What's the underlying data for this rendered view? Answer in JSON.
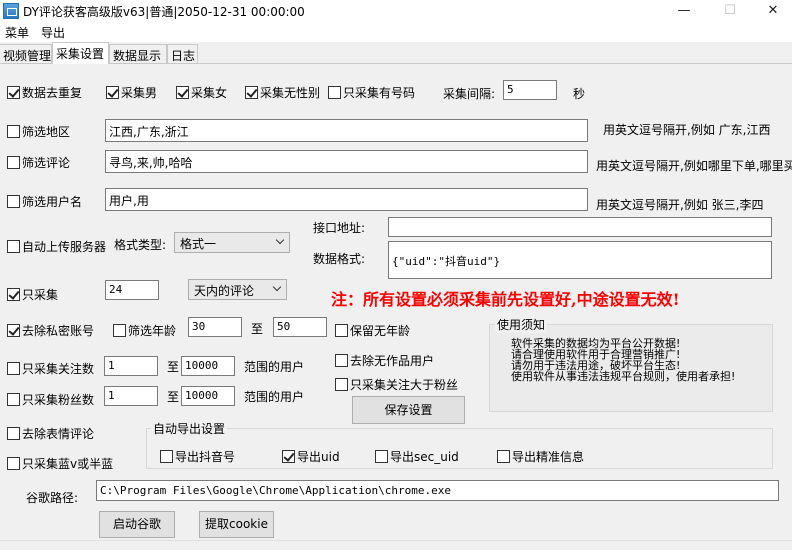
{
  "window": {
    "title": "DY评论获客高级版v63|普通|2050-12-31 00:00:00",
    "minimize_glyph": "—",
    "maximize_glyph": "☐",
    "close_glyph": "✕"
  },
  "menu": {
    "items": [
      "菜单",
      "导出"
    ]
  },
  "tabs": [
    "视频管理",
    "采集设置",
    "数据显示",
    "日志"
  ],
  "active_tab": 1,
  "row1": {
    "dedupe": "数据去重复",
    "male": "采集男",
    "female": "采集女",
    "nogender": "采集无性别",
    "phone_only": "只采集有号码",
    "interval_label": "采集间隔:",
    "interval_value": "5",
    "interval_unit": "秒"
  },
  "filters": {
    "region_label": "筛选地区",
    "region_value": "江西,广东,浙江",
    "region_hint": "用英文逗号隔开,例如 广东,江西",
    "comment_label": "筛选评论",
    "comment_value": "寻鸟,来,帅,哈哈",
    "comment_hint": "用英文逗号隔开,例如哪里下单,哪里买",
    "username_label": "筛选用户名",
    "username_value": "用户,用",
    "username_hint": "用英文逗号隔开,例如   张三,李四"
  },
  "upload": {
    "auto_upload": "自动上传服务器",
    "format_label": "格式类型:",
    "format_value": "格式一",
    "api_label": "接口地址:",
    "api_value": "",
    "data_format_label": "数据格式:",
    "data_format_value": "{\"uid\":\"抖音uid\"}"
  },
  "collect": {
    "only_label": "只采集",
    "only_value": "24",
    "period_value": "天内的评论",
    "notice": "注：所有设置必须采集前先设置好,中途设置无效!"
  },
  "privacy": {
    "remove_private": "去除私密账号",
    "age_filter": "筛选年龄",
    "age_from": "30",
    "age_to_label": "至",
    "age_to": "50",
    "keep_no_age": "保留无年龄"
  },
  "follow": {
    "label": "只采集关注数",
    "from": "1",
    "to_label": "至",
    "to": "10000",
    "suffix": "范围的用户"
  },
  "fans": {
    "label": "只采集粉丝数",
    "from": "1",
    "to_label": "至",
    "to": "10000",
    "suffix": "范围的用户"
  },
  "extra": {
    "remove_no_works": "去除无作品用户",
    "follow_gt_fans": "只采集关注大于粉丝",
    "save_button": "保存设置",
    "remove_emoji": "去除表情评论",
    "blue_v": "只采集蓝v或半蓝"
  },
  "usage": {
    "title": "使用须知",
    "lines": [
      "软件采集的数据均为平台公开数据!",
      "请合理使用软件用于合理营销推广!",
      "请勿用于违法用途，破坏平台生态!",
      "使用软件从事违法违规平台规则，使用者承担!"
    ]
  },
  "export": {
    "title": "自动导出设置",
    "douyin_id": "导出抖音号",
    "uid": "导出uid",
    "sec_uid": "导出sec_uid",
    "precise": "导出精准信息"
  },
  "chrome": {
    "label": "谷歌路径:",
    "path": "C:\\Program Files\\Google\\Chrome\\Application\\chrome.exe",
    "launch_button": "启动谷歌",
    "cookie_button": "提取cookie"
  }
}
